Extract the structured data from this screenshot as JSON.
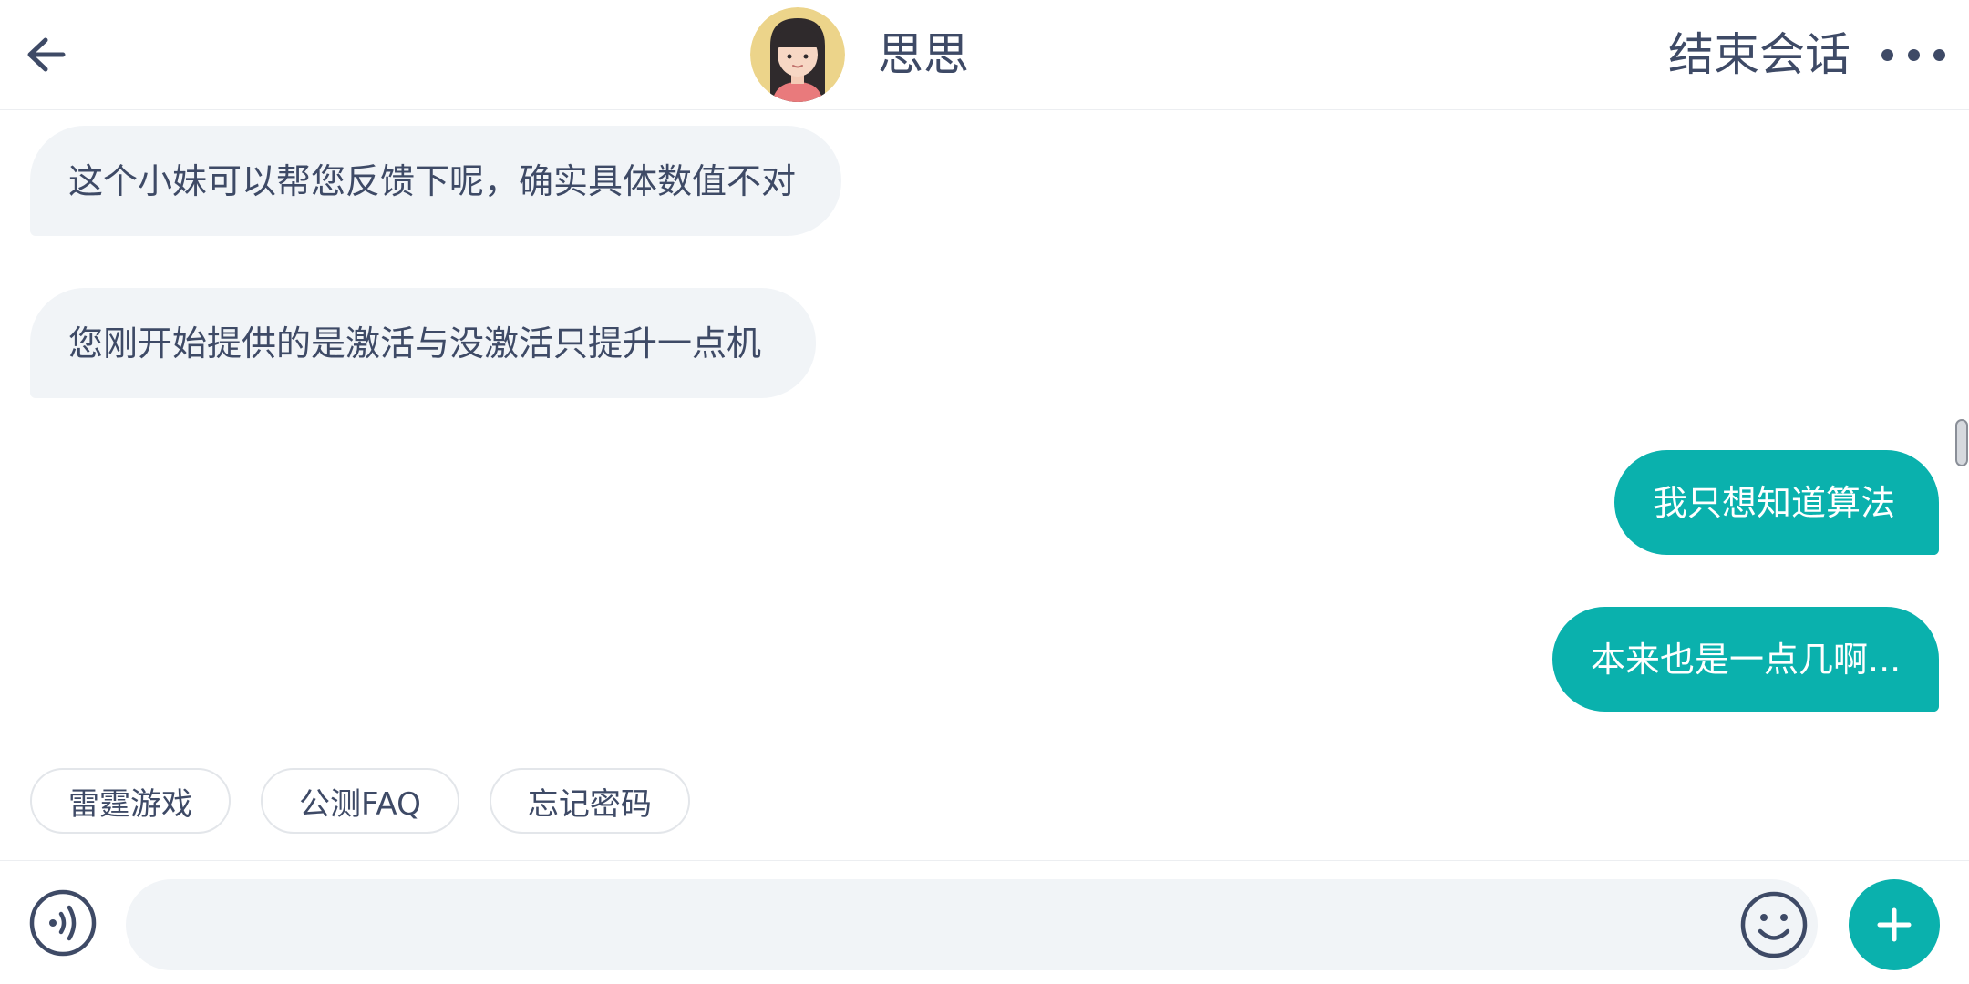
{
  "header": {
    "back_icon": "arrow-left-icon",
    "agent_name": "思思",
    "end_session_label": "结束会话",
    "more_icon": "more-dots-icon"
  },
  "messages": [
    {
      "from": "agent",
      "text": "这个小妹可以帮您反馈下呢，确实具体数值不对"
    },
    {
      "from": "agent",
      "text": "您刚开始提供的是激活与没激活只提升一点机"
    },
    {
      "from": "user",
      "text": "我只想知道算法"
    },
    {
      "from": "user",
      "text": "本来也是一点几啊..."
    }
  ],
  "quick_replies": [
    {
      "label": "雷霆游戏"
    },
    {
      "label": "公测FAQ"
    },
    {
      "label": "忘记密码"
    }
  ],
  "composer": {
    "voice_icon": "voice-icon",
    "input_value": "",
    "placeholder": "",
    "emoji_icon": "emoji-icon",
    "plus_icon": "plus-icon"
  },
  "colors": {
    "accent": "#0ab1ad",
    "text": "#3e4a66",
    "bubble_in": "#f1f4f7"
  }
}
